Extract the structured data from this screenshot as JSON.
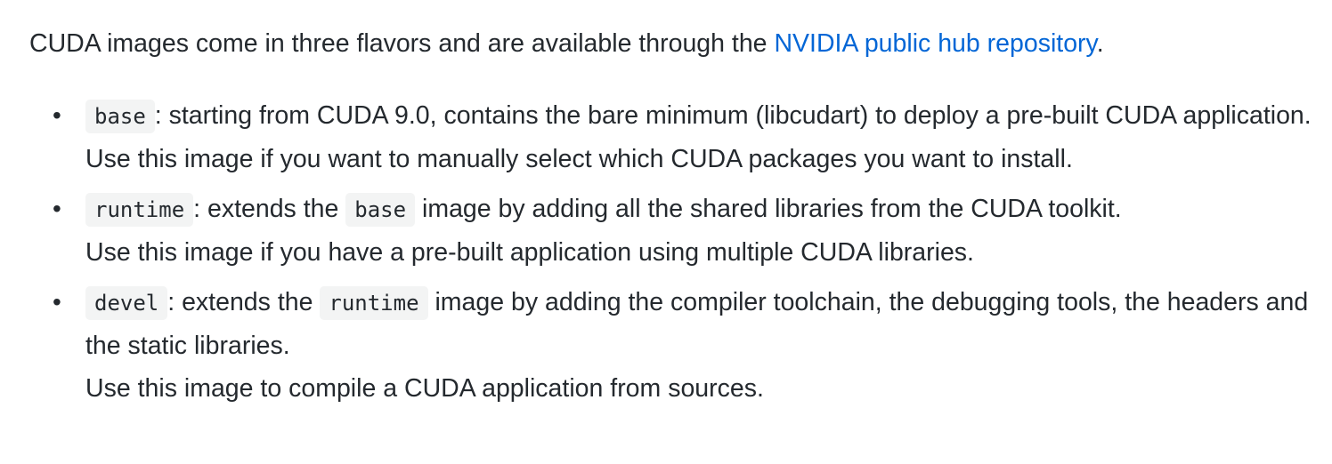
{
  "intro": {
    "text_before": "CUDA images come in three flavors and are available through the ",
    "link_text": "NVIDIA public hub repository",
    "text_after": "."
  },
  "flavors": [
    {
      "name": "base",
      "description": ": starting from CUDA 9.0, contains the bare minimum (libcudart) to deploy a pre-built CUDA application.",
      "usage": "Use this image if you want to manually select which CUDA packages you want to install."
    },
    {
      "name": "runtime",
      "desc_before": ": extends the ",
      "ref": "base",
      "desc_after": " image by adding all the shared libraries from the CUDA toolkit.",
      "usage": "Use this image if you have a pre-built application using multiple CUDA libraries."
    },
    {
      "name": "devel",
      "desc_before": ": extends the ",
      "ref": "runtime",
      "desc_after": " image by adding the compiler toolchain, the debugging tools, the headers and the static libraries.",
      "usage": "Use this image to compile a CUDA application from sources."
    }
  ]
}
